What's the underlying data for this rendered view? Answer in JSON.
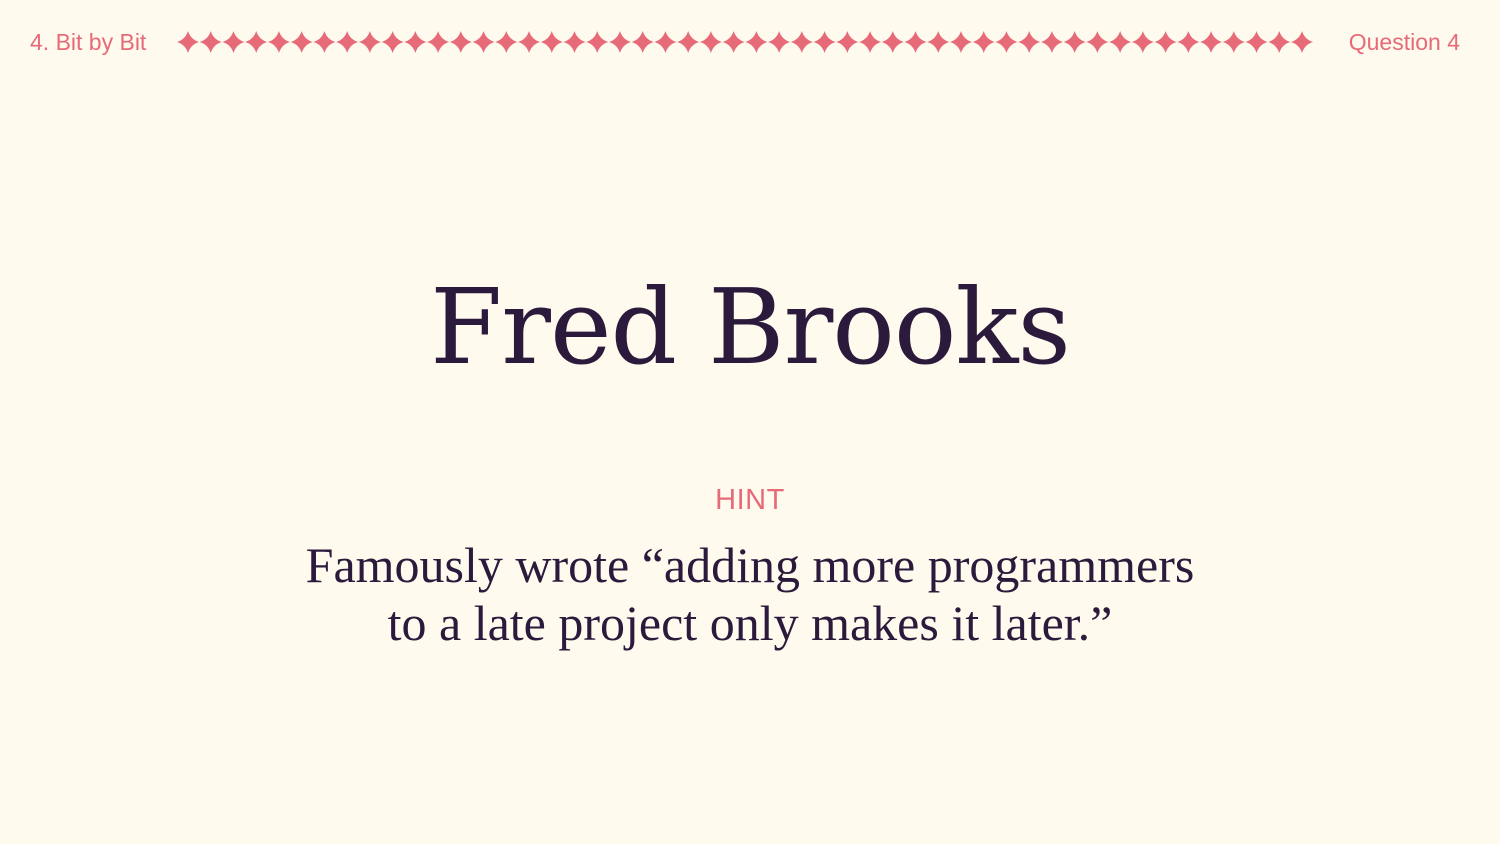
{
  "header": {
    "section": "4. Bit by Bit",
    "question": "Question 4",
    "accent_color": "#e76a78",
    "divider_icon": "four-point-star-icon"
  },
  "card": {
    "answer": "Fred Brooks",
    "hint_label": "HINT",
    "hint_lines": [
      "Famously wrote “adding more programmers",
      "to a late project only makes it later.”"
    ]
  },
  "colors": {
    "background": "#fefaee",
    "text": "#2b1a3b",
    "accent": "#e76a78"
  }
}
